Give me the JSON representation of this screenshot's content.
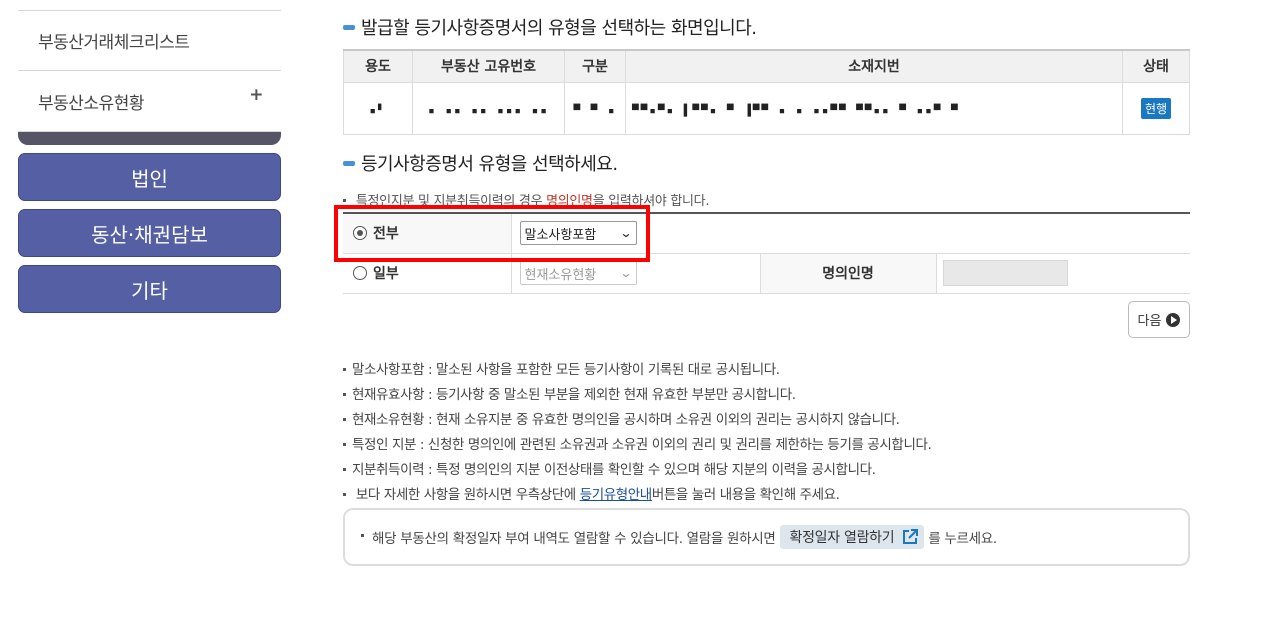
{
  "sidebar": {
    "links": [
      {
        "label": "부동산거래체크리스트",
        "plus": ""
      },
      {
        "label": "부동산소유현황",
        "plus": "+"
      }
    ],
    "buttons": [
      "법인",
      "동산·채권담보",
      "기타"
    ]
  },
  "header": {
    "title": "발급할 등기사항증명서의 유형을 선택하는 화면입니다."
  },
  "info_table": {
    "columns": [
      "용도",
      "부동산 고유번호",
      "구분",
      "소재지번",
      "상태"
    ],
    "row": {
      "usage": "▪▘",
      "unique_no": "▪ ▪▪ ▪▪ ▪▪▪ ▪▪",
      "type": "▀ ▀ ▪",
      "address": "▀▀▪▀▪ ▌▀▀▪ ▀ ▐▀▀ ▪ ▪ ▪▪▀▀ ▀▀▪▪ ▀ ▪▪▀ ▀",
      "status": "현행"
    }
  },
  "select_section": {
    "title": "등기사항증명서 유형을 선택하세요.",
    "note_prefix": "특정인지분 및 지분취득이력의 경우 ",
    "note_highlight": "명의인명",
    "note_suffix": "을 입력하셔야 합니다."
  },
  "options": [
    {
      "label": "전부",
      "selected": true,
      "select_value": "말소사항포함"
    },
    {
      "label": "일부",
      "selected": false,
      "select_value": "현재소유현황",
      "name_label": "명의인명",
      "name_value": ""
    }
  ],
  "next_button": "다음",
  "descriptions": [
    "말소사항포함 : 말소된 사항을 포함한 모든 등기사항이 기록된 대로 공시됩니다.",
    "현재유효사항 : 등기사항 중 말소된 부분을 제외한 현재 유효한 부분만 공시합니다.",
    "현재소유현황 : 현재 소유지분 중 유효한 명의인을 공시하며 소유권 이외의 권리는 공시하지 않습니다.",
    "특정인 지분 : 신청한 명의인에 관련된 소유권과 소유권 이외의 권리 및 권리를 제한하는 등기를 공시합니다.",
    "지분취득이력 : 특정 명의인의 지분 이전상태를 확인할 수 있으며 해당 지분의 이력을 공시합니다."
  ],
  "last_desc": {
    "prefix": "보다 자세한 사항을 원하시면 우측상단에 ",
    "link": "등기유형안내",
    "suffix": "버튼을 눌러 내용을 확인해 주세요."
  },
  "notice": {
    "prefix": "해당 부동산의 확정일자 부여 내역도 열람할 수 있습니다. 열람을 원하시면",
    "button": "확정일자 열람하기",
    "suffix": "를 누르세요."
  },
  "colors": {
    "sidebar_button": "#5560a4",
    "badge": "#1a78c2",
    "highlight_box": "#ff0000"
  }
}
